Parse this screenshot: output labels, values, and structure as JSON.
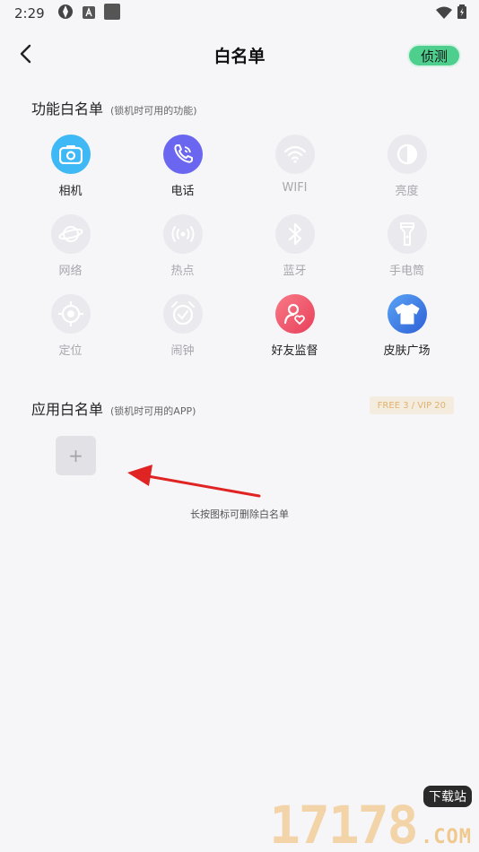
{
  "status_bar": {
    "time": "2:29"
  },
  "header": {
    "title": "白名单",
    "detect_label": "侦测"
  },
  "feature_section": {
    "title": "功能白名单",
    "subtitle": "(锁机时可用的功能)",
    "items": [
      {
        "label": "相机",
        "icon": "camera-icon",
        "enabled": true,
        "color": "#3fb9f6"
      },
      {
        "label": "电话",
        "icon": "phone-icon",
        "enabled": true,
        "color": "#6b66f0"
      },
      {
        "label": "WIFI",
        "icon": "wifi-icon",
        "enabled": false
      },
      {
        "label": "亮度",
        "icon": "brightness-icon",
        "enabled": false
      },
      {
        "label": "网络",
        "icon": "network-icon",
        "enabled": false
      },
      {
        "label": "热点",
        "icon": "hotspot-icon",
        "enabled": false
      },
      {
        "label": "蓝牙",
        "icon": "bluetooth-icon",
        "enabled": false
      },
      {
        "label": "手电筒",
        "icon": "flashlight-icon",
        "enabled": false
      },
      {
        "label": "定位",
        "icon": "location-icon",
        "enabled": false
      },
      {
        "label": "闹钟",
        "icon": "alarm-icon",
        "enabled": false
      },
      {
        "label": "好友监督",
        "icon": "friend-supervise-icon",
        "enabled": true,
        "color": "#f0556c"
      },
      {
        "label": "皮肤广场",
        "icon": "skin-icon",
        "enabled": true,
        "color": "#3a7be8"
      }
    ]
  },
  "app_section": {
    "title": "应用白名单",
    "subtitle": "(锁机时可用的APP)",
    "badge": "FREE 3 / VIP 20",
    "add_label": "+",
    "hint": "长按图标可删除白名单"
  },
  "watermark": {
    "digits": "17178",
    "tag": "下载站",
    "domain": ".COM"
  }
}
